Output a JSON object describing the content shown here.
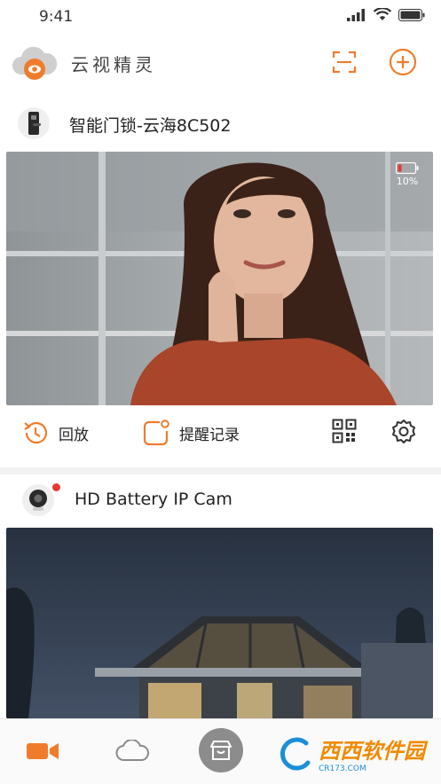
{
  "status": {
    "time": "9:41"
  },
  "header": {
    "title": "云视精灵"
  },
  "devices": [
    {
      "name": "智能门锁-云海8C502",
      "battery": "10%",
      "actions": {
        "playback": "回放",
        "alerts": "提醒记录"
      }
    },
    {
      "name": "HD Battery IP Cam"
    }
  ],
  "watermark": {
    "brand": "西西软件园",
    "url": "CR173.COM"
  },
  "colors": {
    "accent": "#f07c2b",
    "battery_low": "#e53935"
  }
}
